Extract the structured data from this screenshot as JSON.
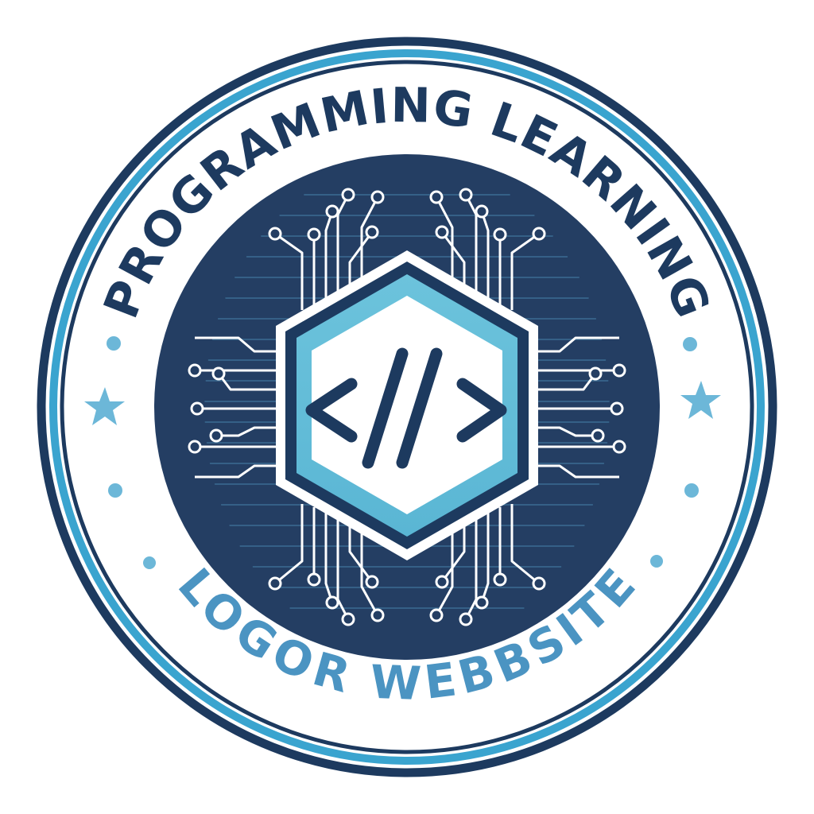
{
  "logo": {
    "top_text": "PROGRAMMING LEARNING",
    "bottom_text": "LOGOR WEBBSITE",
    "center_symbol": "code-brackets-icon",
    "colors": {
      "navy": "#1d3a5f",
      "dark_inner": "#243e63",
      "teal": "#3aa4cf",
      "light_blue": "#6cc3dc",
      "text_light": "#4b94c2",
      "white": "#ffffff"
    }
  }
}
